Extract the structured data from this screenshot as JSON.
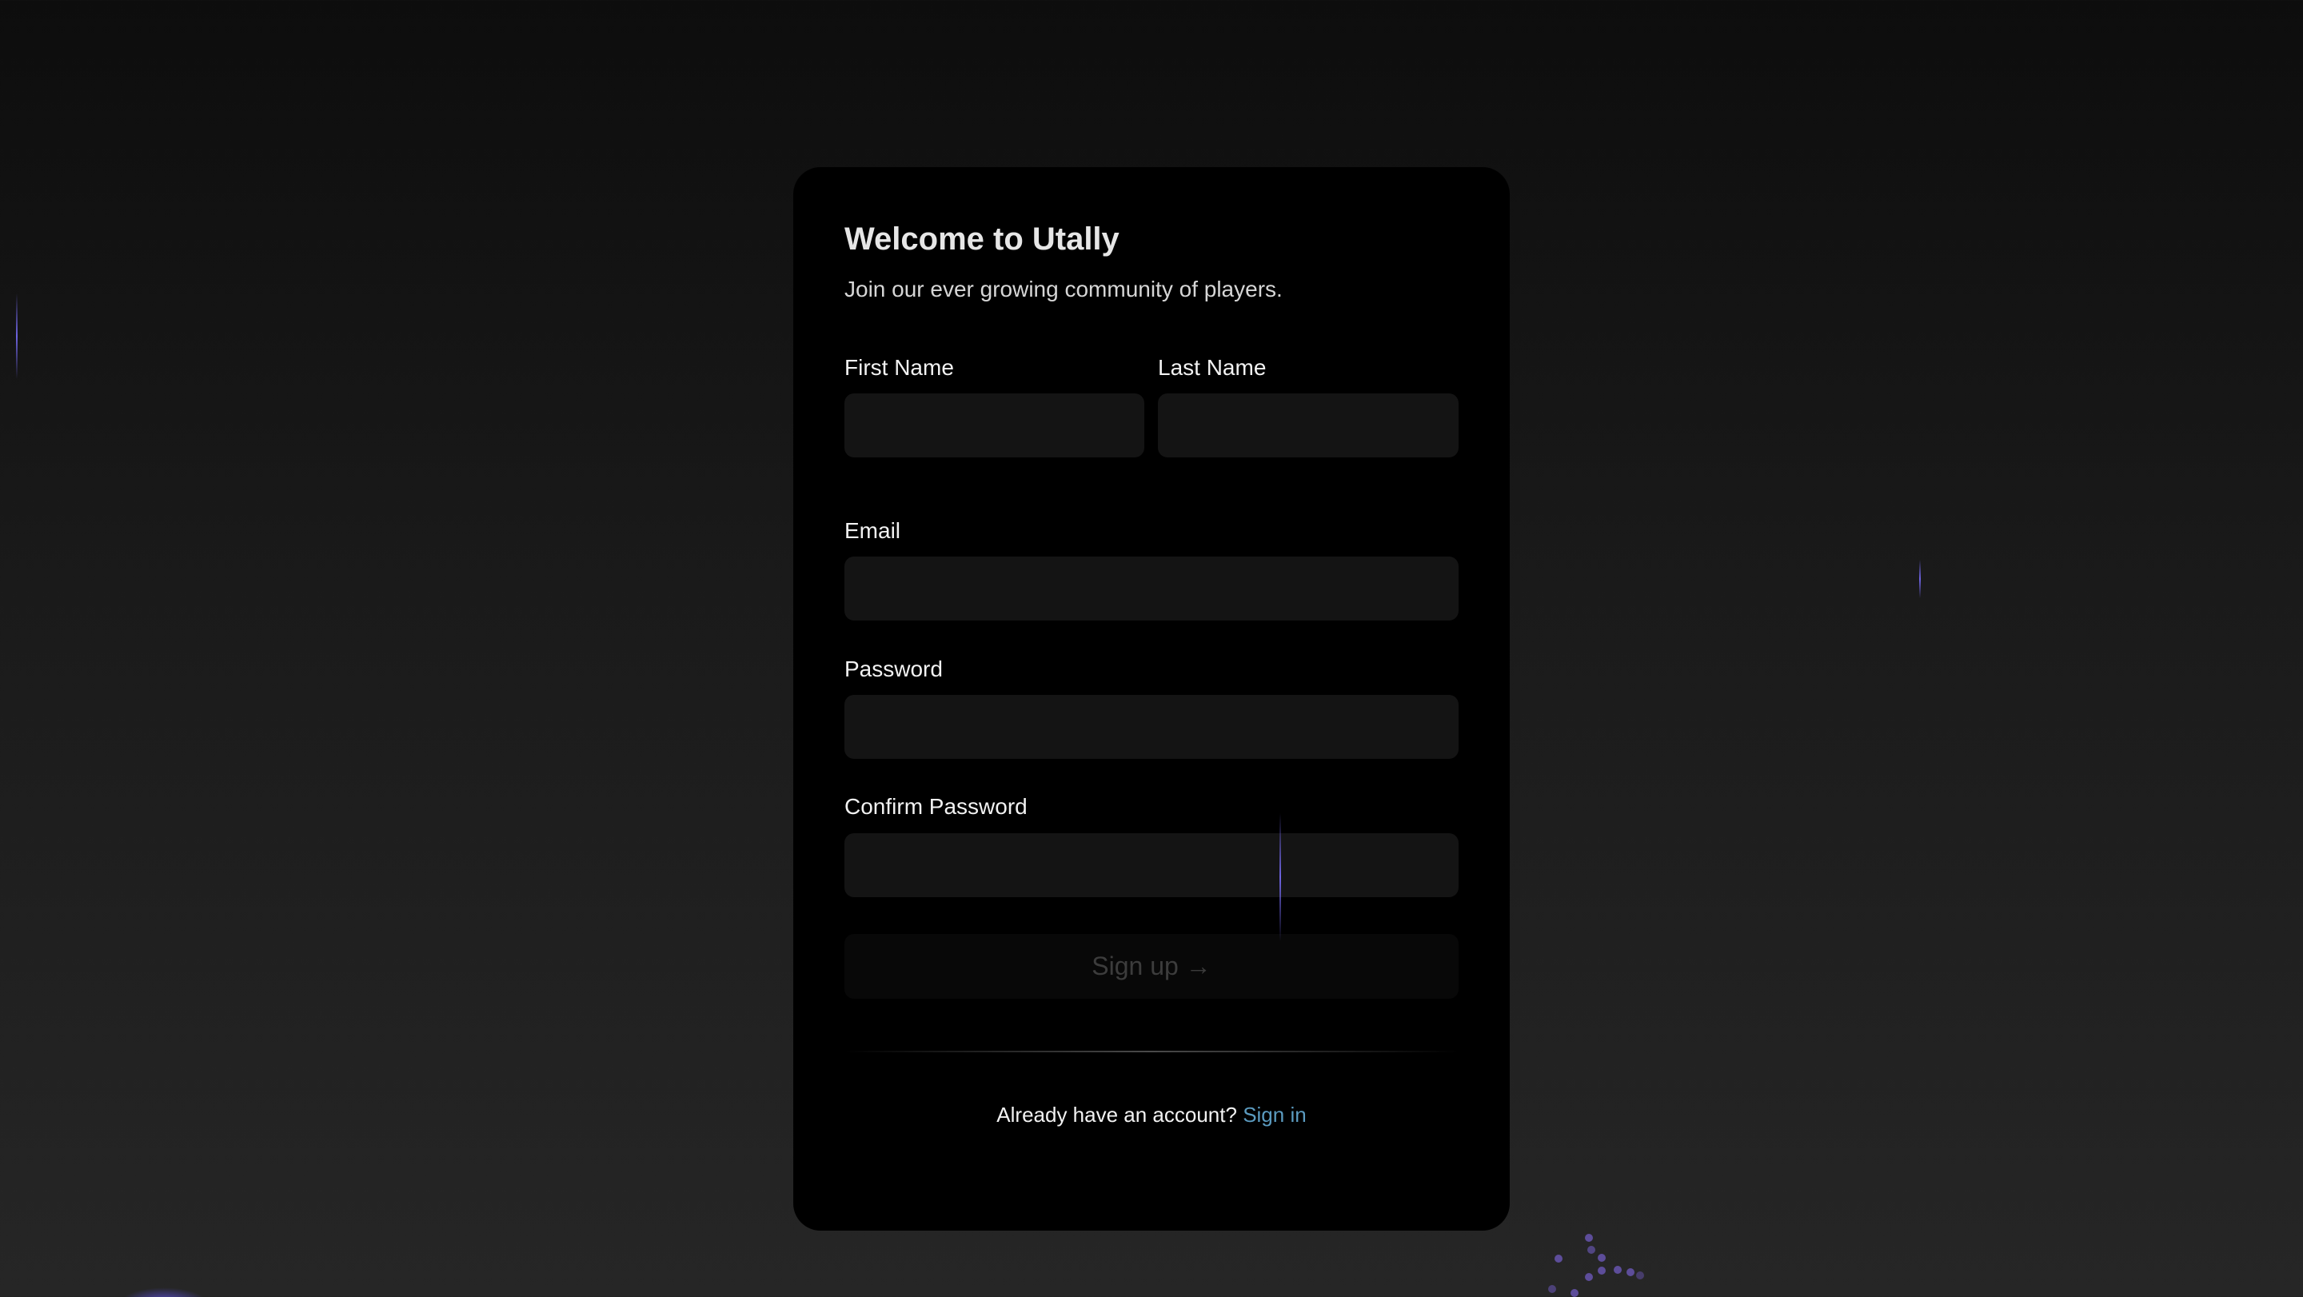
{
  "card": {
    "title": "Welcome to Utally",
    "subtitle": "Join our ever growing community of players.",
    "fields": {
      "first_name": {
        "label": "First Name",
        "value": ""
      },
      "last_name": {
        "label": "Last Name",
        "value": ""
      },
      "email": {
        "label": "Email",
        "value": ""
      },
      "password": {
        "label": "Password",
        "value": ""
      },
      "confirm_password": {
        "label": "Confirm Password",
        "value": ""
      }
    },
    "submit_label": "Sign up →",
    "footer_text": "Already have an account?",
    "signin_link": "Sign in"
  },
  "colors": {
    "accent": "#6d63e0",
    "link": "#5b9bc0",
    "card": "#000000",
    "input": "#141414"
  }
}
